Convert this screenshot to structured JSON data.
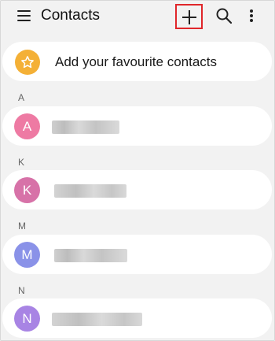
{
  "header": {
    "title": "Contacts",
    "menu_icon": "hamburger-icon",
    "add_icon": "plus-icon",
    "search_icon": "search-icon",
    "more_icon": "more-vert-icon"
  },
  "favourites": {
    "label": "Add your favourite contacts",
    "icon": "star-icon",
    "icon_color": "#f4b036"
  },
  "sections": [
    {
      "letter": "A",
      "contact": {
        "initial": "A",
        "avatar_color": "#ee7aa3",
        "name_redacted": true
      }
    },
    {
      "letter": "K",
      "contact": {
        "initial": "K",
        "avatar_color": "#d772a8",
        "name_redacted": true
      }
    },
    {
      "letter": "M",
      "contact": {
        "initial": "M",
        "avatar_color": "#8a92e8",
        "name_redacted": true
      }
    },
    {
      "letter": "N",
      "contact": {
        "initial": "N",
        "avatar_color": "#a884e4",
        "name_redacted": true
      }
    }
  ],
  "colors": {
    "background": "#f2f2f2",
    "highlight_border": "#e0262a"
  }
}
